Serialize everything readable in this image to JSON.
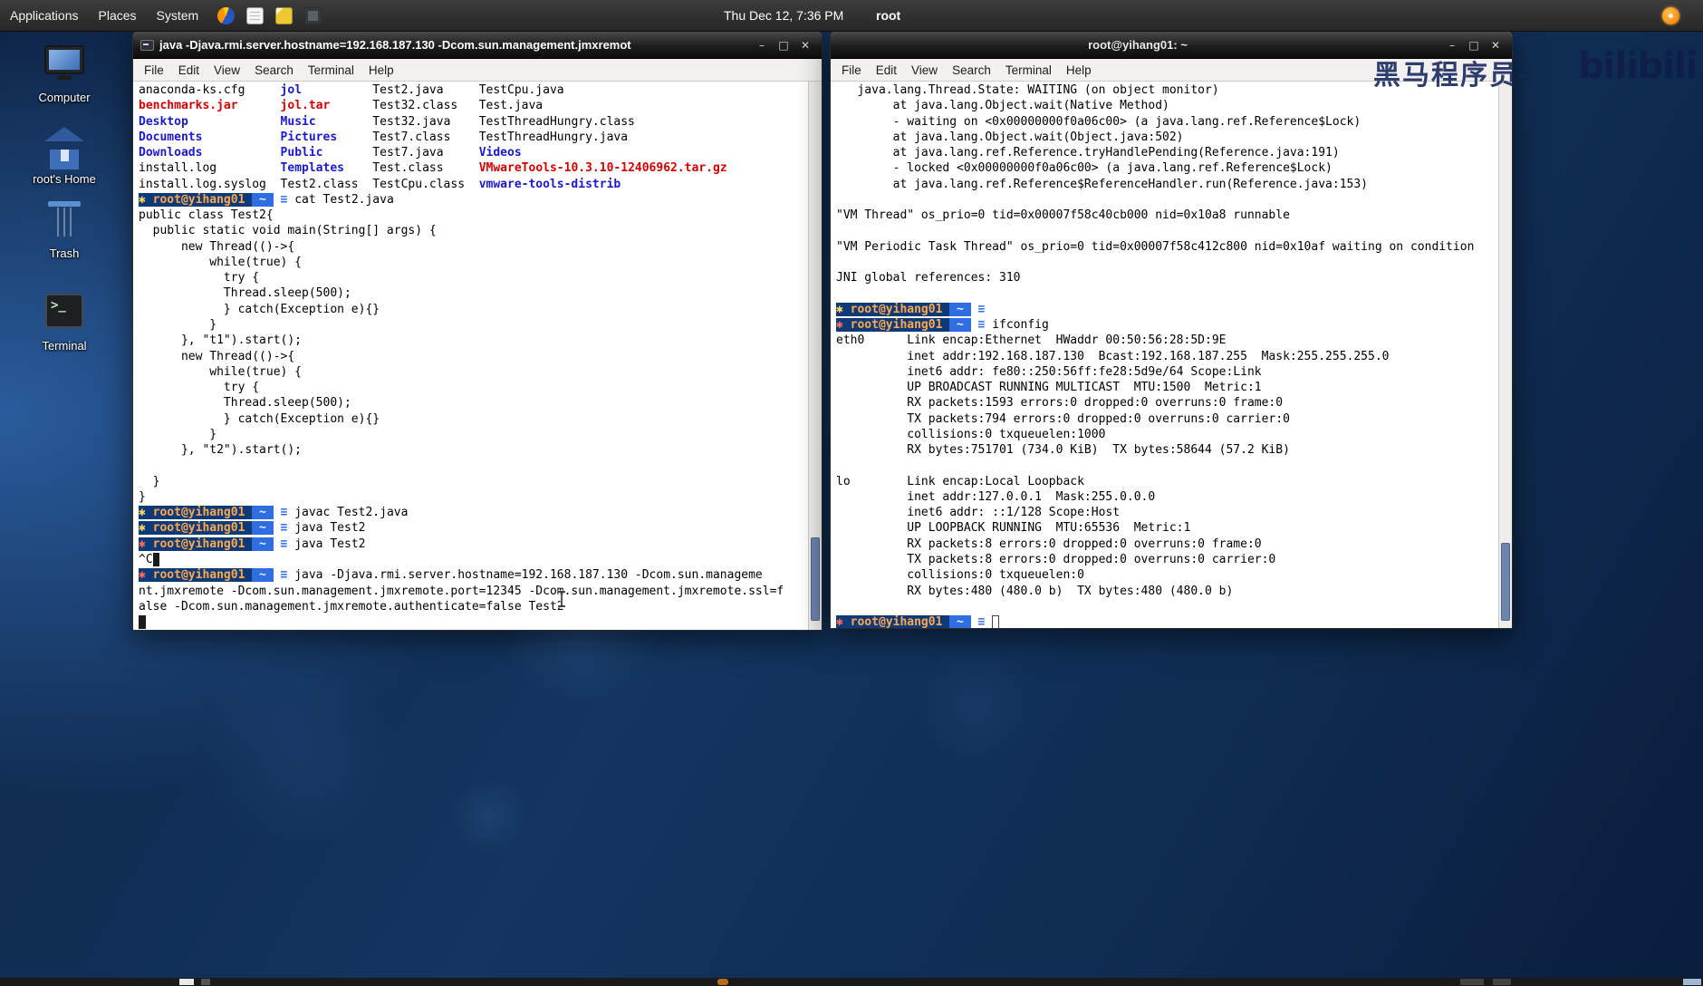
{
  "colors": {
    "directory": "#1a1acd",
    "archive": "#d40000",
    "prompt_user_fg": "#ffa94d",
    "prompt_bg": "#0f3a78",
    "prompt_segment": "#2e6ee0",
    "terminal_bg": "#ffffff",
    "terminal_fg": "#000000"
  },
  "panel": {
    "menus": [
      "Applications",
      "Places",
      "System"
    ],
    "icons": [
      "firefox-icon",
      "editor-icon",
      "notes-icon",
      "screenshot-icon"
    ],
    "clock": "Thu Dec 12, 7:36 PM",
    "user": "root"
  },
  "desktop": {
    "icons": [
      {
        "label": "Computer"
      },
      {
        "label": "root's Home"
      },
      {
        "label": "Trash"
      },
      {
        "label": "Terminal"
      }
    ],
    "watermarks": {
      "text_cn": "黑马程序员-",
      "logo": "bilibili"
    }
  },
  "window1": {
    "title": "java -Djava.rmi.server.hostname=192.168.187.130 -Dcom.sun.management.jmxremot",
    "menu": [
      "File",
      "Edit",
      "View",
      "Search",
      "Terminal",
      "Help"
    ],
    "buttons": {
      "minimize": "–",
      "maximize": "□",
      "close": "✕"
    },
    "lines": [
      [
        [
          "",
          "anaconda-ks.cfg     "
        ],
        [
          "dir",
          "jol          "
        ],
        [
          "",
          "Test2.java     TestCpu.java"
        ]
      ],
      [
        [
          "arc",
          "benchmarks.jar      "
        ],
        [
          "arc",
          "jol.tar      "
        ],
        [
          "",
          "Test32.class   Test.java"
        ]
      ],
      [
        [
          "dir",
          "Desktop             "
        ],
        [
          "dir",
          "Music        "
        ],
        [
          "",
          "Test32.java    TestThreadHungry.class"
        ]
      ],
      [
        [
          "dir",
          "Documents           "
        ],
        [
          "dir",
          "Pictures     "
        ],
        [
          "",
          "Test7.class    TestThreadHungry.java"
        ]
      ],
      [
        [
          "dir",
          "Downloads           "
        ],
        [
          "dir",
          "Public       "
        ],
        [
          "",
          "Test7.java     "
        ],
        [
          "dir",
          "Videos"
        ]
      ],
      [
        [
          "",
          "install.log         "
        ],
        [
          "dir",
          "Templates    "
        ],
        [
          "",
          "Test.class     "
        ],
        [
          "arc",
          "VMwareTools-10.3.10-12406962.tar.gz"
        ]
      ],
      [
        [
          "",
          "install.log.syslog  Test2.class  TestCpu.class  "
        ],
        [
          "dir",
          "vmware-tools-distrib"
        ]
      ],
      [
        [
          "py",
          "✱ "
        ],
        [
          "pu",
          "root@yihang01 "
        ],
        [
          "pg",
          " ~ "
        ],
        [
          "pi",
          " ≡ "
        ],
        [
          "",
          "cat Test2.java"
        ]
      ],
      [
        [
          "",
          "public class Test2{"
        ]
      ],
      [
        [
          "",
          "  public static void main(String[] args) {"
        ]
      ],
      [
        [
          "",
          "      new Thread(()->{"
        ]
      ],
      [
        [
          "",
          "          while(true) {"
        ]
      ],
      [
        [
          "",
          "            try {"
        ]
      ],
      [
        [
          "",
          "            Thread.sleep(500);"
        ]
      ],
      [
        [
          "",
          "            } catch(Exception e){}"
        ]
      ],
      [
        [
          "",
          "          }"
        ]
      ],
      [
        [
          "",
          "      }, \"t1\").start();"
        ]
      ],
      [
        [
          "",
          "      new Thread(()->{"
        ]
      ],
      [
        [
          "",
          "          while(true) {"
        ]
      ],
      [
        [
          "",
          "            try {"
        ]
      ],
      [
        [
          "",
          "            Thread.sleep(500);"
        ]
      ],
      [
        [
          "",
          "            } catch(Exception e){}"
        ]
      ],
      [
        [
          "",
          "          }"
        ]
      ],
      [
        [
          "",
          "      }, \"t2\").start();"
        ]
      ],
      [],
      [
        [
          "",
          "  }"
        ]
      ],
      [
        [
          "",
          "}"
        ]
      ],
      [
        [
          "py",
          "✱ "
        ],
        [
          "pu",
          "root@yihang01 "
        ],
        [
          "pg",
          " ~ "
        ],
        [
          "pi",
          " ≡ "
        ],
        [
          "",
          "javac Test2.java"
        ]
      ],
      [
        [
          "py",
          "✱ "
        ],
        [
          "pu",
          "root@yihang01 "
        ],
        [
          "pg",
          " ~ "
        ],
        [
          "pi",
          " ≡ "
        ],
        [
          "",
          "java Test2"
        ]
      ],
      [
        [
          "pr",
          "✱ "
        ],
        [
          "pu",
          "root@yihang01 "
        ],
        [
          "pg",
          " ~ "
        ],
        [
          "pi",
          " ≡ "
        ],
        [
          "",
          "java Test2"
        ]
      ],
      [
        [
          "",
          "^C"
        ],
        [
          "cur",
          " "
        ]
      ],
      [
        [
          "pr",
          "✱ "
        ],
        [
          "pu",
          "root@yihang01 "
        ],
        [
          "pg",
          " ~ "
        ],
        [
          "pi",
          " ≡ "
        ],
        [
          "",
          "java -Djava.rmi.server.hostname=192.168.187.130 -Dcom.sun.manageme"
        ]
      ],
      [
        [
          "",
          "nt.jmxremote -Dcom.sun.management.jmxremote.port=12345 -Dcom.sun.management.jmxremote.ssl=f"
        ]
      ],
      [
        [
          "",
          "alse -Dcom.sun.management.jmxremote.authenticate=false Test2"
        ]
      ],
      [
        [
          "cur",
          " "
        ]
      ]
    ]
  },
  "window2": {
    "title": "root@yihang01: ~",
    "menu": [
      "File",
      "Edit",
      "View",
      "Search",
      "Terminal",
      "Help"
    ],
    "buttons": {
      "minimize": "–",
      "maximize": "□",
      "close": "✕"
    },
    "lines": [
      [
        [
          "",
          "   java.lang.Thread.State: WAITING (on object monitor)"
        ]
      ],
      [
        [
          "",
          "        at java.lang.Object.wait(Native Method)"
        ]
      ],
      [
        [
          "",
          "        - waiting on <0x00000000f0a06c00> (a java.lang.ref.Reference$Lock)"
        ]
      ],
      [
        [
          "",
          "        at java.lang.Object.wait(Object.java:502)"
        ]
      ],
      [
        [
          "",
          "        at java.lang.ref.Reference.tryHandlePending(Reference.java:191)"
        ]
      ],
      [
        [
          "",
          "        - locked <0x00000000f0a06c00> (a java.lang.ref.Reference$Lock)"
        ]
      ],
      [
        [
          "",
          "        at java.lang.ref.Reference$ReferenceHandler.run(Reference.java:153)"
        ]
      ],
      [],
      [
        [
          "",
          "\"VM Thread\" os_prio=0 tid=0x00007f58c40cb000 nid=0x10a8 runnable"
        ]
      ],
      [],
      [
        [
          "",
          "\"VM Periodic Task Thread\" os_prio=0 tid=0x00007f58c412c800 nid=0x10af waiting on condition"
        ]
      ],
      [],
      [
        [
          "",
          "JNI global references: 310"
        ]
      ],
      [],
      [
        [
          "py",
          "✱ "
        ],
        [
          "pu",
          "root@yihang01 "
        ],
        [
          "pg",
          " ~ "
        ],
        [
          "pi",
          " ≡ "
        ]
      ],
      [
        [
          "pr",
          "✱ "
        ],
        [
          "pu",
          "root@yihang01 "
        ],
        [
          "pg",
          " ~ "
        ],
        [
          "pi",
          " ≡ "
        ],
        [
          "",
          "ifconfig"
        ]
      ],
      [
        [
          "",
          "eth0      Link encap:Ethernet  HWaddr 00:50:56:28:5D:9E"
        ]
      ],
      [
        [
          "",
          "          inet addr:192.168.187.130  Bcast:192.168.187.255  Mask:255.255.255.0"
        ]
      ],
      [
        [
          "",
          "          inet6 addr: fe80::250:56ff:fe28:5d9e/64 Scope:Link"
        ]
      ],
      [
        [
          "",
          "          UP BROADCAST RUNNING MULTICAST  MTU:1500  Metric:1"
        ]
      ],
      [
        [
          "",
          "          RX packets:1593 errors:0 dropped:0 overruns:0 frame:0"
        ]
      ],
      [
        [
          "",
          "          TX packets:794 errors:0 dropped:0 overruns:0 carrier:0"
        ]
      ],
      [
        [
          "",
          "          collisions:0 txqueuelen:1000"
        ]
      ],
      [
        [
          "",
          "          RX bytes:751701 (734.0 KiB)  TX bytes:58644 (57.2 KiB)"
        ]
      ],
      [],
      [
        [
          "",
          "lo        Link encap:Local Loopback"
        ]
      ],
      [
        [
          "",
          "          inet addr:127.0.0.1  Mask:255.0.0.0"
        ]
      ],
      [
        [
          "",
          "          inet6 addr: ::1/128 Scope:Host"
        ]
      ],
      [
        [
          "",
          "          UP LOOPBACK RUNNING  MTU:65536  Metric:1"
        ]
      ],
      [
        [
          "",
          "          RX packets:8 errors:0 dropped:0 overruns:0 frame:0"
        ]
      ],
      [
        [
          "",
          "          TX packets:8 errors:0 dropped:0 overruns:0 carrier:0"
        ]
      ],
      [
        [
          "",
          "          collisions:0 txqueuelen:0"
        ]
      ],
      [
        [
          "",
          "          RX bytes:480 (480.0 b)  TX bytes:480 (480.0 b)"
        ]
      ],
      [],
      [
        [
          "pr",
          "✱ "
        ],
        [
          "pu",
          "root@yihang01 "
        ],
        [
          "pg",
          " ~ "
        ],
        [
          "pi",
          " ≡ "
        ],
        [
          "hcur",
          " "
        ]
      ]
    ]
  }
}
